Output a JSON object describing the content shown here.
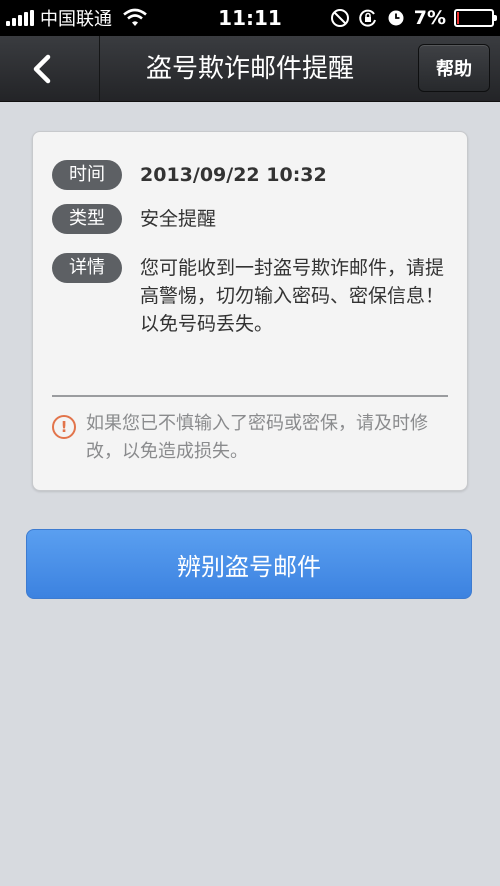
{
  "status_bar": {
    "carrier": "中国联通",
    "time": "11:11",
    "battery_percent": "7%",
    "battery_level": 0.07,
    "icons": [
      "signal-icon",
      "wifi-icon",
      "do-not-disturb-icon",
      "orientation-lock-icon",
      "alarm-icon",
      "battery-icon"
    ]
  },
  "nav": {
    "back_icon": "chevron-left-icon",
    "title": "盗号欺诈邮件提醒",
    "help_label": "帮助"
  },
  "card": {
    "rows": [
      {
        "label": "时间",
        "value": "2013/09/22 10:32"
      },
      {
        "label": "类型",
        "value": "安全提醒"
      },
      {
        "label": "详情",
        "value": "您可能收到一封盗号欺诈邮件，请提高警惕，切勿输入密码、密保信息！以免号码丢失。"
      }
    ],
    "warning_icon": "exclamation-circle-icon",
    "warning_text": "如果您已不慎输入了密码或密保，请及时修改，以免造成损失。"
  },
  "action_button_label": "辨别盗号邮件",
  "colors": {
    "accent_button": "#4a90e8",
    "warning": "#e2744b",
    "label_pill": "#5d6064",
    "background": "#d7dadf"
  }
}
